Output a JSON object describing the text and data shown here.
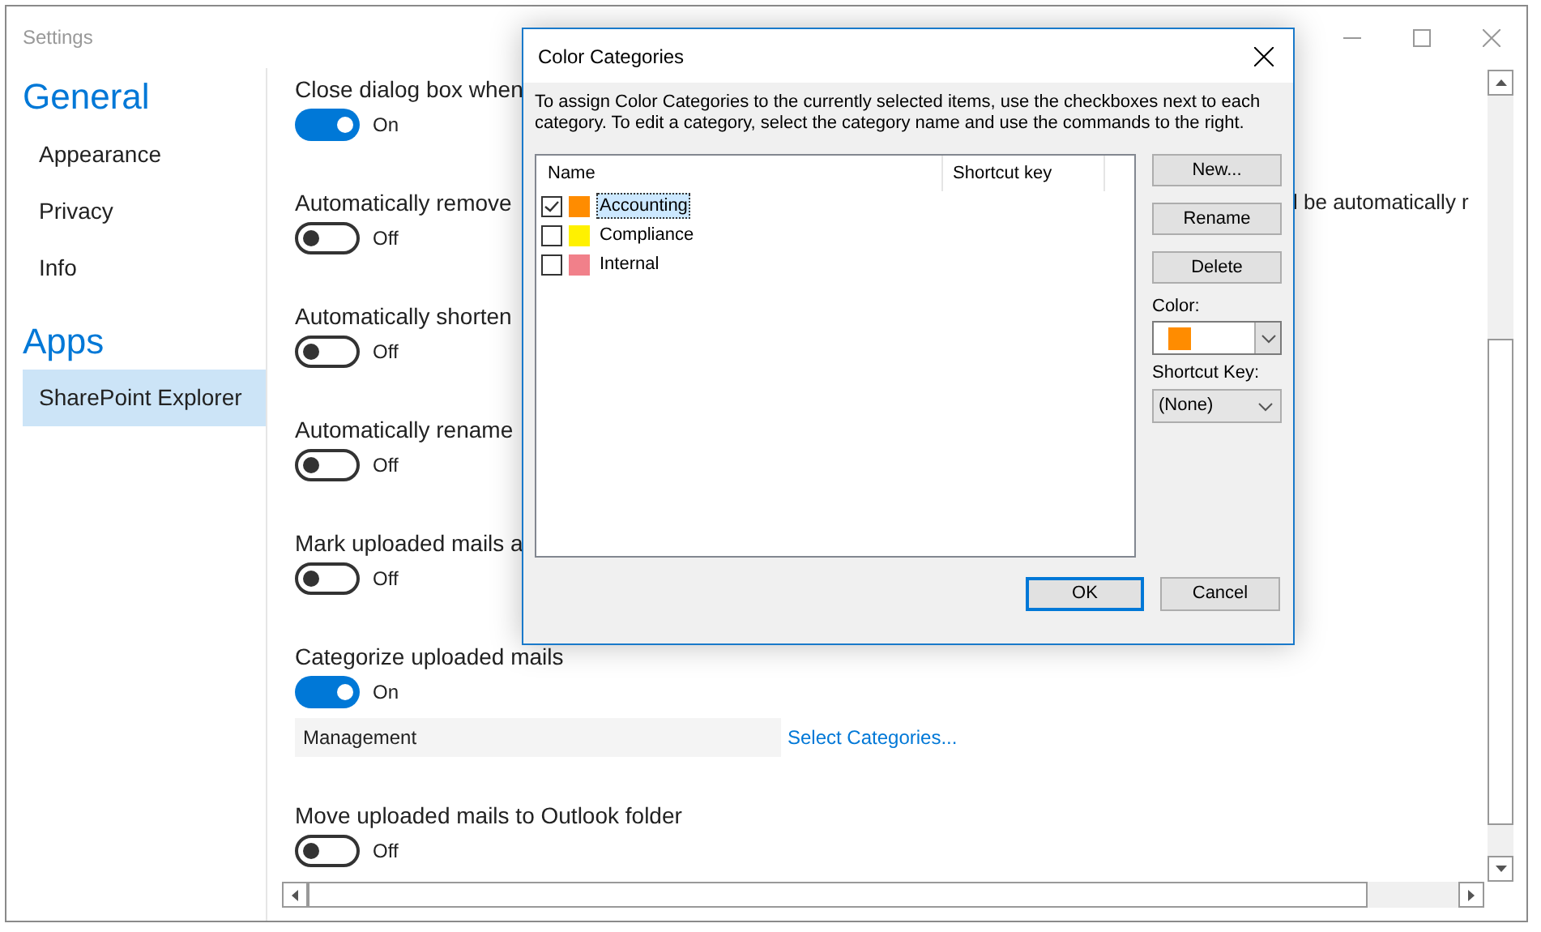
{
  "window": {
    "title": "Settings"
  },
  "sidebar": {
    "sections": [
      {
        "heading": "General",
        "items": [
          {
            "label": "Appearance",
            "selected": false
          },
          {
            "label": "Privacy",
            "selected": false
          },
          {
            "label": "Info",
            "selected": false
          }
        ]
      },
      {
        "heading": "Apps",
        "items": [
          {
            "label": "SharePoint Explorer",
            "selected": true
          }
        ]
      }
    ]
  },
  "settings": [
    {
      "label": "Close dialog box when",
      "toggle": {
        "on": true,
        "text": "On"
      }
    },
    {
      "label": "Automatically remove",
      "tail": "l be automatically r",
      "toggle": {
        "on": false,
        "text": "Off"
      }
    },
    {
      "label": "Automatically shorten",
      "toggle": {
        "on": false,
        "text": "Off"
      }
    },
    {
      "label": "Automatically rename",
      "toggle": {
        "on": false,
        "text": "Off"
      }
    },
    {
      "label": "Mark uploaded mails a",
      "toggle": {
        "on": false,
        "text": "Off"
      }
    },
    {
      "label": "Categorize uploaded mails",
      "toggle": {
        "on": true,
        "text": "On"
      },
      "field": {
        "value": "Management"
      },
      "link": "Select Categories..."
    },
    {
      "label": "Move uploaded mails to Outlook folder",
      "toggle": {
        "on": false,
        "text": "Off"
      }
    }
  ],
  "dialog": {
    "title": "Color Categories",
    "description": "To assign Color Categories to the currently selected items, use the checkboxes next to each category.  To edit a category, select the category name and use the commands to the right.",
    "columns": [
      "Name",
      "Shortcut key"
    ],
    "categories": [
      {
        "name": "Accounting",
        "color": "#ff8c00",
        "checked": true,
        "selected": true
      },
      {
        "name": "Compliance",
        "color": "#fff100",
        "checked": false,
        "selected": false
      },
      {
        "name": "Internal",
        "color": "#f1808a",
        "checked": false,
        "selected": false
      }
    ],
    "side_buttons": [
      "New...",
      "Rename",
      "Delete"
    ],
    "color_label": "Color:",
    "color": "#ff8c00",
    "shortcut_label": "Shortcut Key:",
    "shortcut_value": "(None)",
    "ok": "OK",
    "cancel": "Cancel"
  }
}
